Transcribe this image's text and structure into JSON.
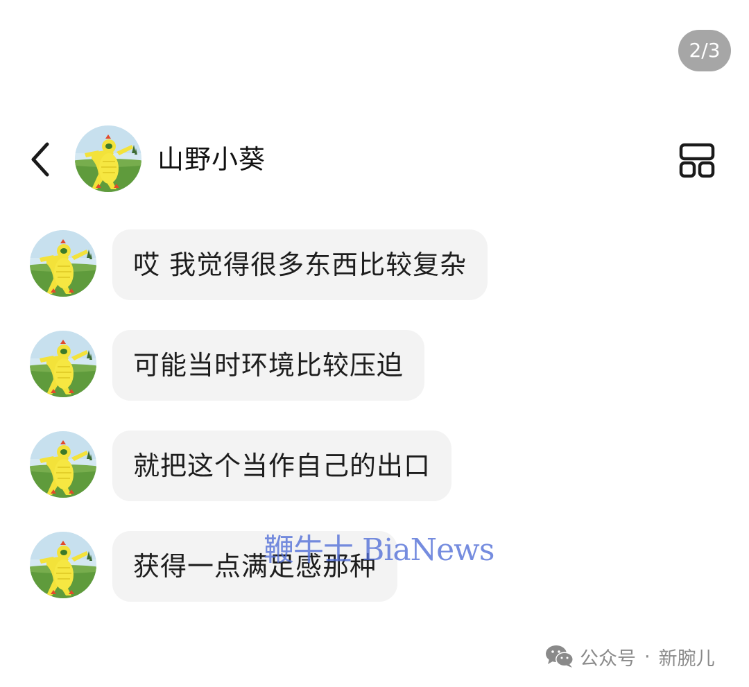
{
  "pager": {
    "text": "2/3"
  },
  "header": {
    "name": "山野小葵",
    "back_icon": "chevron-left-icon",
    "menu_icon": "grid-icon"
  },
  "messages": [
    {
      "text": "哎 我觉得很多东西比较复杂"
    },
    {
      "text": "可能当时环境比较压迫"
    },
    {
      "text": "就把这个当作自己的出口"
    },
    {
      "text": "获得一点满足感那种"
    }
  ],
  "watermark": {
    "text": "鞭牛士 BiaNews"
  },
  "footer": {
    "icon": "wechat-icon",
    "account_type": "公众号",
    "separator": "·",
    "account_name": "新腕儿"
  },
  "colors": {
    "bubble": "#f3f3f3",
    "pager": "#a6a6a6",
    "watermark": "#4e6cd6",
    "avatar_grass": "#5b9a3a",
    "avatar_sky": "#cfe6f2",
    "avatar_figure": "#f4e33a"
  }
}
